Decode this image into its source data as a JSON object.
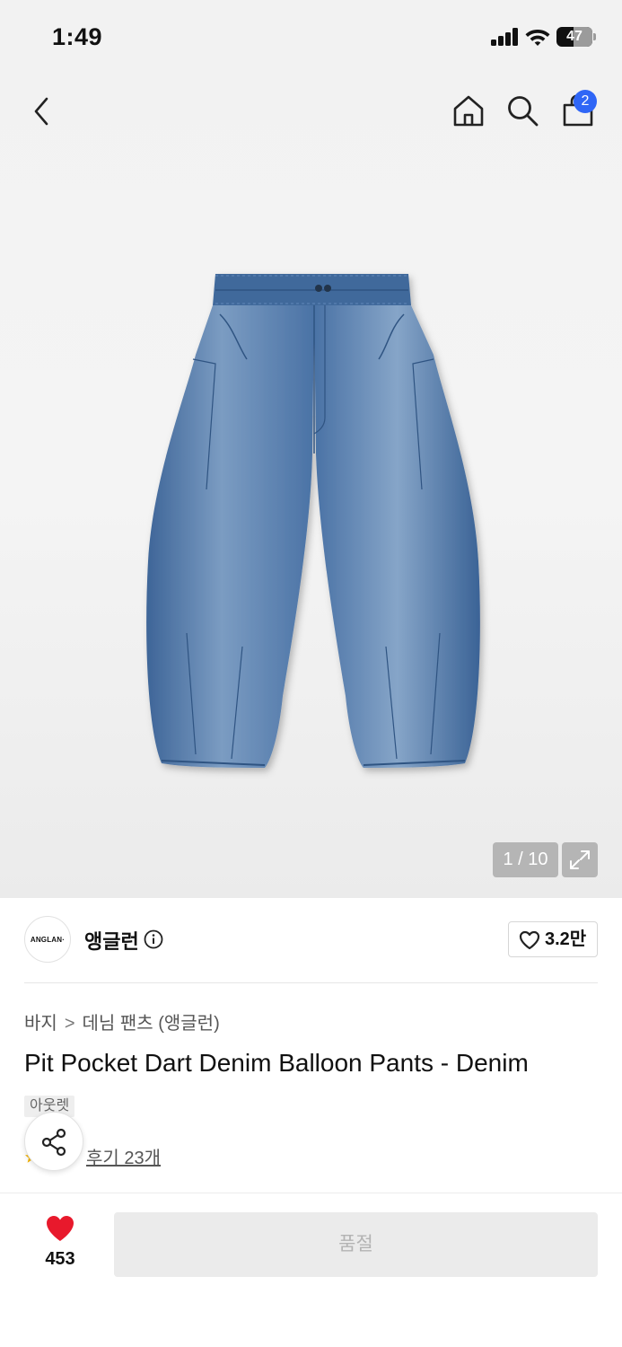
{
  "status_bar": {
    "time": "1:49",
    "battery": "47",
    "battery_level": 0.47
  },
  "nav": {
    "cart_count": "2"
  },
  "hero": {
    "counter": "1 / 10"
  },
  "brand": {
    "logo_text": "ANGLAN·",
    "name": "앵글런",
    "likes": "3.2만"
  },
  "breadcrumb": {
    "category": "바지",
    "separator": ">",
    "subcategory": "데님 팬츠 (앵글런)"
  },
  "product": {
    "title": "Pit Pocket Dart Denim Balloon Pants - Denim",
    "tag": "아웃렛",
    "reviews_label": "후기 23개"
  },
  "footer": {
    "favorite_count": "453",
    "buy_label": "품절"
  },
  "colors": {
    "badge": "#2f66f6",
    "heart": "#e8192c",
    "denim": "#4a72a5"
  },
  "icons": [
    "back-icon",
    "home-icon",
    "search-icon",
    "shopping-bag-icon",
    "expand-icon",
    "info-icon",
    "heart-outline-icon",
    "star-icon",
    "share-icon",
    "heart-filled-icon"
  ]
}
